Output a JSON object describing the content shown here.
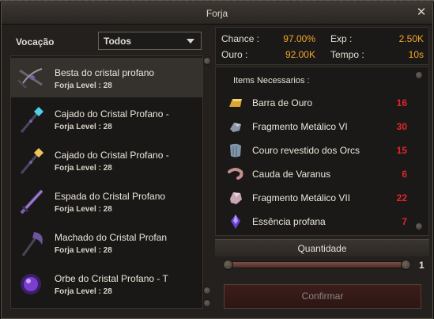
{
  "window": {
    "title": "Forja",
    "close_label": "✕"
  },
  "vocation": {
    "label": "Vocação",
    "selected": "Todos"
  },
  "recipes": [
    {
      "name": "Besta do cristal profano",
      "level": "Forja Level : 28",
      "icon": "crossbow-icon",
      "selected": true
    },
    {
      "name": "Cajado do Cristal Profano -",
      "level": "Forja Level : 28",
      "icon": "blue-staff-icon"
    },
    {
      "name": "Cajado do Cristal Profano -",
      "level": "Forja Level : 28",
      "icon": "gold-staff-icon"
    },
    {
      "name": "Espada do Cristal Profano",
      "level": "Forja Level : 28",
      "icon": "sword-icon"
    },
    {
      "name": "Machado do Cristal Profan",
      "level": "Forja Level : 28",
      "icon": "axe-icon"
    },
    {
      "name": "Orbe do Cristal Profano - T",
      "level": "Forja Level : 28",
      "icon": "orb-icon"
    }
  ],
  "stats": {
    "chance_label": "Chance :",
    "chance_value": "97.00%",
    "ouro_label": "Ouro :",
    "ouro_value": "92.00K",
    "exp_label": "Exp :",
    "exp_value": "2.50K",
    "tempo_label": "Tempo :",
    "tempo_value": "10s"
  },
  "requirements": {
    "title": "Items Necessarios :",
    "items": [
      {
        "name": "Barra de Ouro",
        "qty": "16",
        "icon": "gold-bar-icon"
      },
      {
        "name": "Fragmento Metálico VI",
        "qty": "30",
        "icon": "metal-fragment-icon"
      },
      {
        "name": "Couro revestido dos Orcs",
        "qty": "15",
        "icon": "leather-icon"
      },
      {
        "name": "Cauda de Varanus",
        "qty": "6",
        "icon": "tail-icon"
      },
      {
        "name": "Fragmento Metálico VII",
        "qty": "22",
        "icon": "pink-fragment-icon"
      },
      {
        "name": "Essência profana",
        "qty": "7",
        "icon": "essence-icon"
      }
    ]
  },
  "quantity": {
    "label": "Quantidade",
    "value": "1"
  },
  "confirm_label": "Confirmar",
  "colors": {
    "accent": "#f0a62a",
    "required": "#e0262a"
  }
}
